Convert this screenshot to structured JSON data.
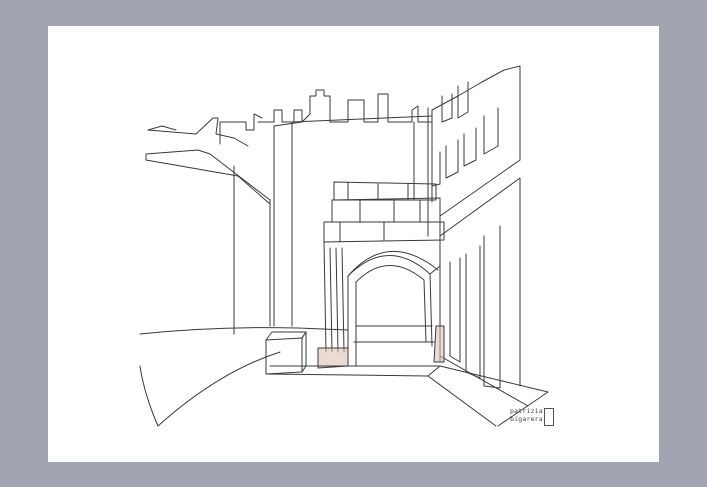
{
  "artwork": {
    "signature_line1": "patrizia",
    "signature_line2": "bigarera"
  },
  "colors": {
    "frame": "#a1a5b1",
    "paper": "#ffffff",
    "ink": "#3a3a3a",
    "wash": "#d9bfb0"
  }
}
